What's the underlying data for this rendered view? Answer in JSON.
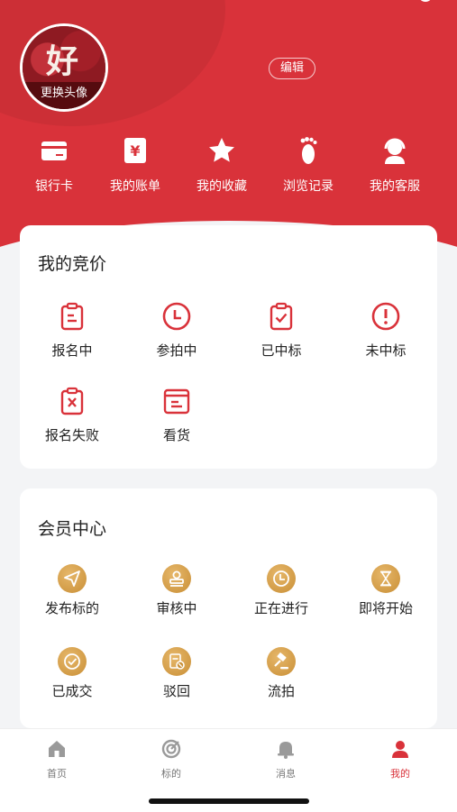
{
  "profile": {
    "avatar_text": "好",
    "change_avatar": "更换头像",
    "edit_label": "编辑"
  },
  "shortcuts": [
    {
      "label": "银行卡",
      "icon": "bank-card-icon"
    },
    {
      "label": "我的账单",
      "icon": "bill-icon"
    },
    {
      "label": "我的收藏",
      "icon": "star-icon"
    },
    {
      "label": "浏览记录",
      "icon": "footprint-icon"
    },
    {
      "label": "我的客服",
      "icon": "customer-service-icon"
    }
  ],
  "bidding": {
    "title": "我的竞价",
    "items": [
      {
        "label": "报名中",
        "icon": "clipboard-icon"
      },
      {
        "label": "参拍中",
        "icon": "clock-icon"
      },
      {
        "label": "已中标",
        "icon": "clipboard-check-icon"
      },
      {
        "label": "未中标",
        "icon": "alert-icon"
      },
      {
        "label": "报名失败",
        "icon": "clipboard-x-icon"
      },
      {
        "label": "看货",
        "icon": "box-icon"
      }
    ]
  },
  "member": {
    "title": "会员中心",
    "items": [
      {
        "label": "发布标的",
        "icon": "send-icon"
      },
      {
        "label": "审核中",
        "icon": "stamp-icon"
      },
      {
        "label": "正在进行",
        "icon": "clock-icon"
      },
      {
        "label": "即将开始",
        "icon": "hourglass-icon"
      },
      {
        "label": "已成交",
        "icon": "check-circle-icon"
      },
      {
        "label": "驳回",
        "icon": "reject-icon"
      },
      {
        "label": "流拍",
        "icon": "gavel-icon"
      }
    ]
  },
  "tabs": [
    {
      "label": "首页",
      "icon": "home-icon"
    },
    {
      "label": "标的",
      "icon": "target-icon"
    },
    {
      "label": "消息",
      "icon": "bell-icon"
    },
    {
      "label": "我的",
      "icon": "user-icon"
    }
  ],
  "colors": {
    "primary": "#d9323a",
    "gold": "#d4a04f",
    "inactive": "#9a9a9a"
  }
}
